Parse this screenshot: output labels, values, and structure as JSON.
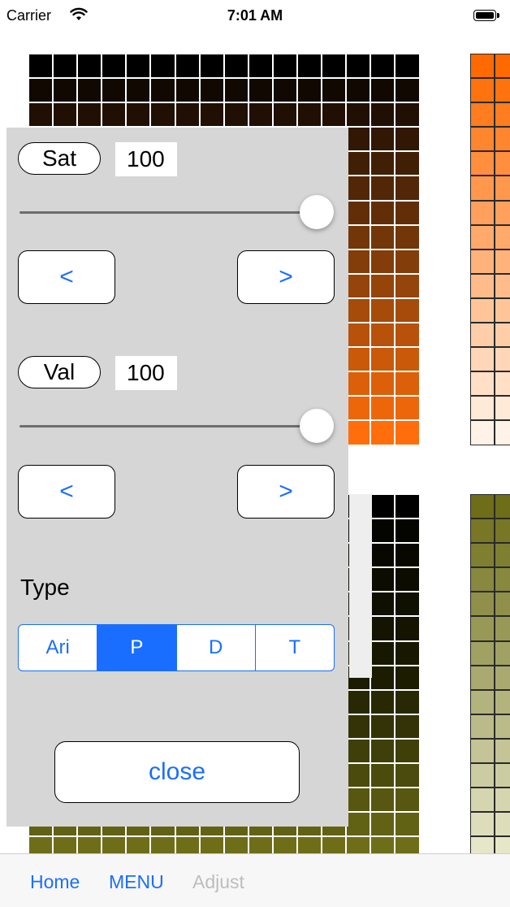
{
  "status_bar": {
    "carrier": "Carrier",
    "time": "7:01 AM"
  },
  "panel": {
    "sat": {
      "label": "Sat",
      "value": "100",
      "slider_fraction": 1.0
    },
    "val": {
      "label": "Val",
      "value": "100",
      "slider_fraction": 1.0
    },
    "step_prev": "<",
    "step_next": ">",
    "type_label": "Type",
    "type_options": [
      "Ari",
      "P",
      "D",
      "T"
    ],
    "type_selected": "P",
    "close_label": "close"
  },
  "toolbar": {
    "home": "Home",
    "menu": "MENU",
    "adjust": "Adjust"
  },
  "colors": {
    "accent": "#1a6eff",
    "panel_bg": "#d6d6d6",
    "palette_black_top": "#000000",
    "palette_brown_mid": "#7a3a0a",
    "palette_orange_bottom": "#ff6e0a",
    "palette_orange_right_top": "#ff6a00",
    "palette_peach_right_bottom": "#fff2e6",
    "palette_olive_dark": "#1c1c00",
    "palette_olive_mid": "#6e6e18",
    "palette_olive_light": "#e6e6c8"
  },
  "icons": {
    "wifi": "wifi-icon",
    "battery": "battery-icon"
  }
}
